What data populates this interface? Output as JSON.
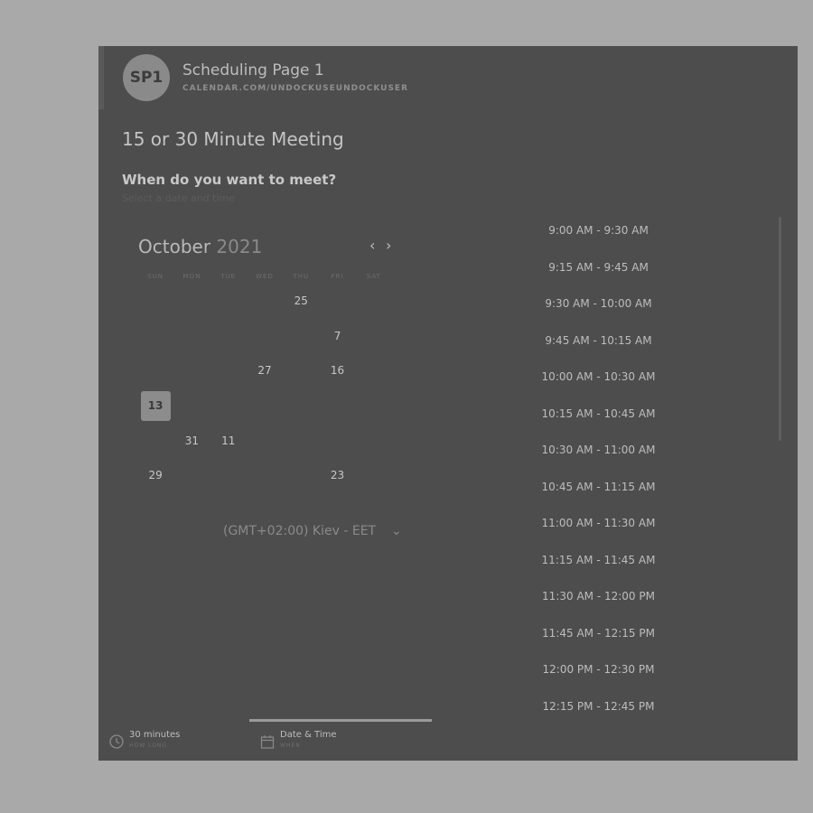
{
  "header": {
    "avatar_initials": "SP1",
    "page_name": "Scheduling Page 1",
    "page_url": "CALENDAR.COM/UNDOCKUSEUNDOCKUSER"
  },
  "meeting": {
    "title": "15 or 30 Minute Meeting",
    "prompt": "When do you want to meet?",
    "subprompt": "Select a date and time"
  },
  "calendar": {
    "month": "October",
    "year": "2021",
    "weekdays": [
      "SUN",
      "MON",
      "TUE",
      "WED",
      "THU",
      "FRI",
      "SAT"
    ],
    "weeks": [
      [
        {
          "d": ""
        },
        {
          "d": ""
        },
        {
          "d": ""
        },
        {
          "d": ""
        },
        {
          "d": "25",
          "avail": true
        },
        {
          "d": ""
        },
        {
          "d": ""
        }
      ],
      [
        {
          "d": ""
        },
        {
          "d": ""
        },
        {
          "d": ""
        },
        {
          "d": ""
        },
        {
          "d": ""
        },
        {
          "d": "7",
          "avail": true
        },
        {
          "d": ""
        }
      ],
      [
        {
          "d": ""
        },
        {
          "d": ""
        },
        {
          "d": ""
        },
        {
          "d": "27",
          "avail": true
        },
        {
          "d": ""
        },
        {
          "d": "16",
          "avail": true
        },
        {
          "d": ""
        }
      ],
      [
        {
          "d": "13",
          "selected": true
        },
        {
          "d": ""
        },
        {
          "d": ""
        },
        {
          "d": ""
        },
        {
          "d": ""
        },
        {
          "d": ""
        },
        {
          "d": ""
        }
      ],
      [
        {
          "d": ""
        },
        {
          "d": "31",
          "avail": true
        },
        {
          "d": "11",
          "avail": true
        },
        {
          "d": ""
        },
        {
          "d": ""
        },
        {
          "d": ""
        },
        {
          "d": ""
        }
      ],
      [
        {
          "d": "29",
          "avail": true
        },
        {
          "d": ""
        },
        {
          "d": ""
        },
        {
          "d": ""
        },
        {
          "d": ""
        },
        {
          "d": "23",
          "avail": true
        },
        {
          "d": ""
        }
      ]
    ],
    "timezone": "(GMT+02:00) Kiev - EET"
  },
  "time_slots": [
    "9:00 AM - 9:30 AM",
    "9:15 AM - 9:45 AM",
    "9:30 AM - 10:00 AM",
    "9:45 AM - 10:15 AM",
    "10:00 AM - 10:30 AM",
    "10:15 AM - 10:45 AM",
    "10:30 AM - 11:00 AM",
    "10:45 AM - 11:15 AM",
    "11:00 AM - 11:30 AM",
    "11:15 AM - 11:45 AM",
    "11:30 AM - 12:00 PM",
    "11:45 AM - 12:15 PM",
    "12:00 PM - 12:30 PM",
    "12:15 PM - 12:45 PM"
  ],
  "footer": {
    "duration_label": "30 minutes",
    "duration_sub": "HOW LONG",
    "date_label": "Date & Time",
    "date_sub": "WHEN"
  },
  "colors": {
    "overlay": "#4d4d4d",
    "page_bg": "#a9a9a9",
    "selected_day": "#8c8c8c"
  }
}
